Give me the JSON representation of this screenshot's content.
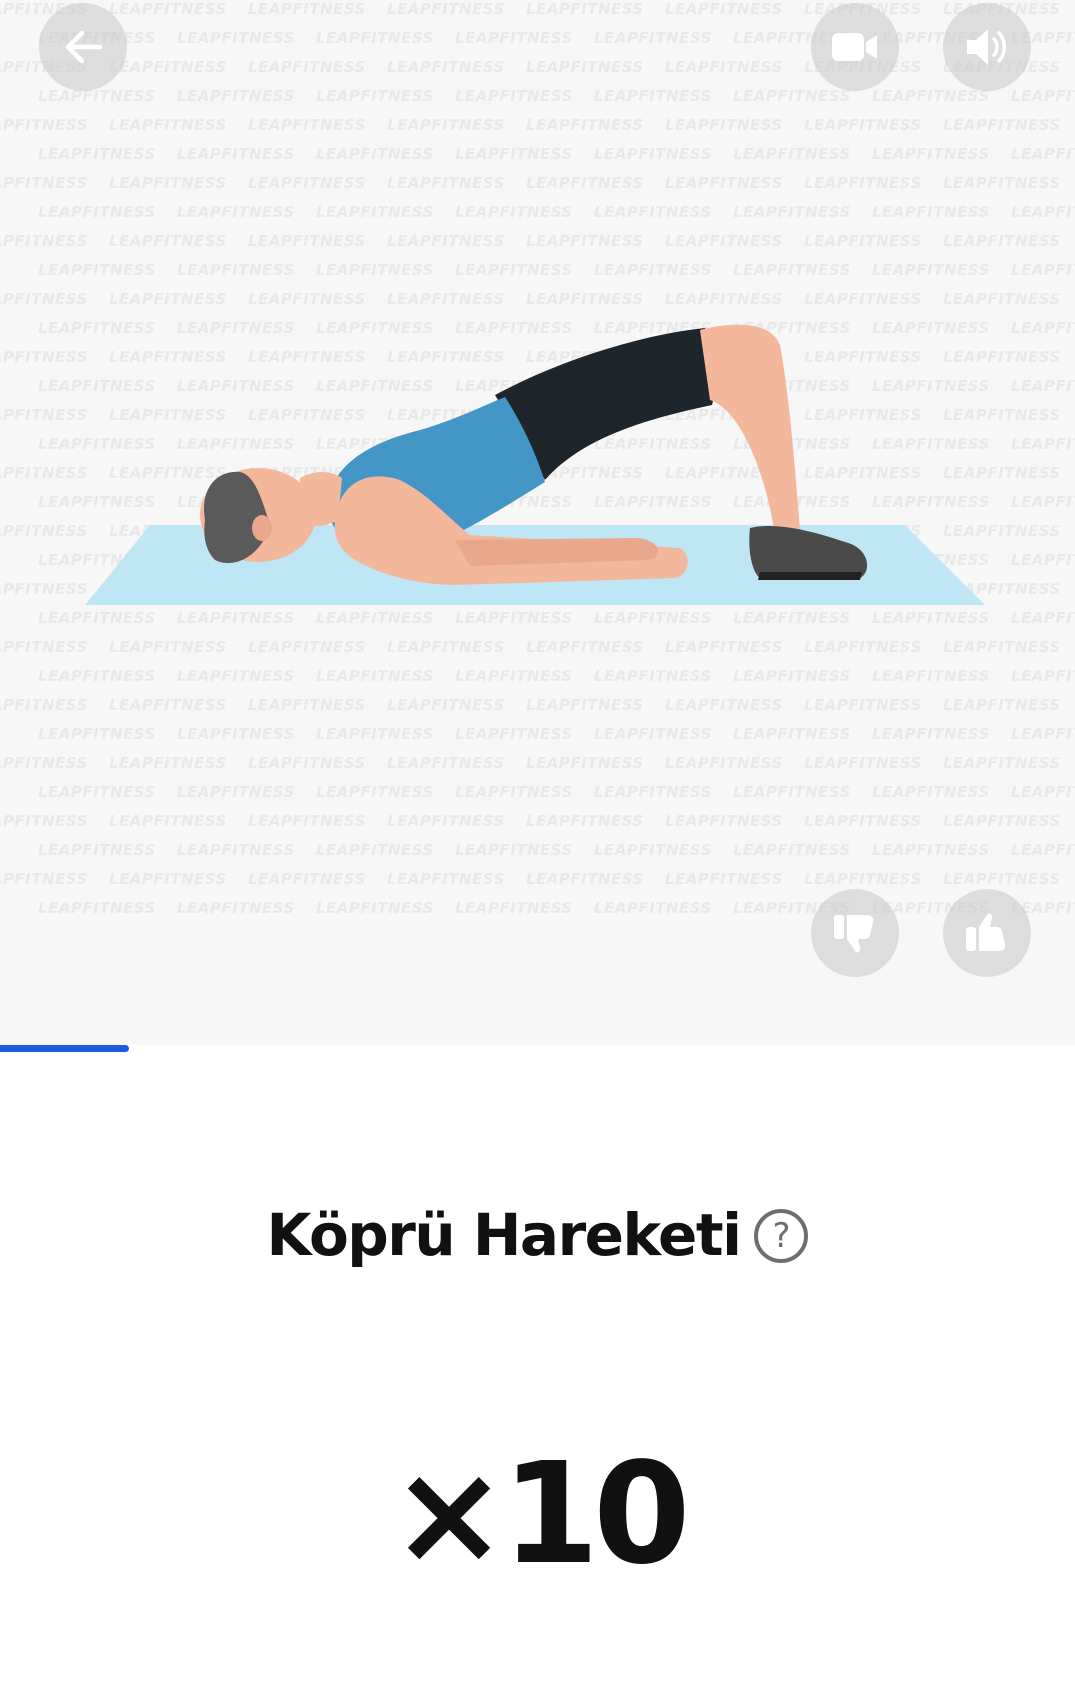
{
  "media": {
    "watermark_text": "LEAPFITNESS",
    "accent_color": "#1a5de0",
    "progress_fraction": 0.12
  },
  "controls": {
    "back_icon": "arrow-left-icon",
    "video_icon": "video-camera-icon",
    "sound_icon": "speaker-icon",
    "dislike_icon": "thumbs-down-icon",
    "like_icon": "thumbs-up-icon"
  },
  "exercise": {
    "title": "Köprü Hareketi",
    "help_icon": "question-circle-icon",
    "help_glyph": "?",
    "reps": "×10"
  }
}
